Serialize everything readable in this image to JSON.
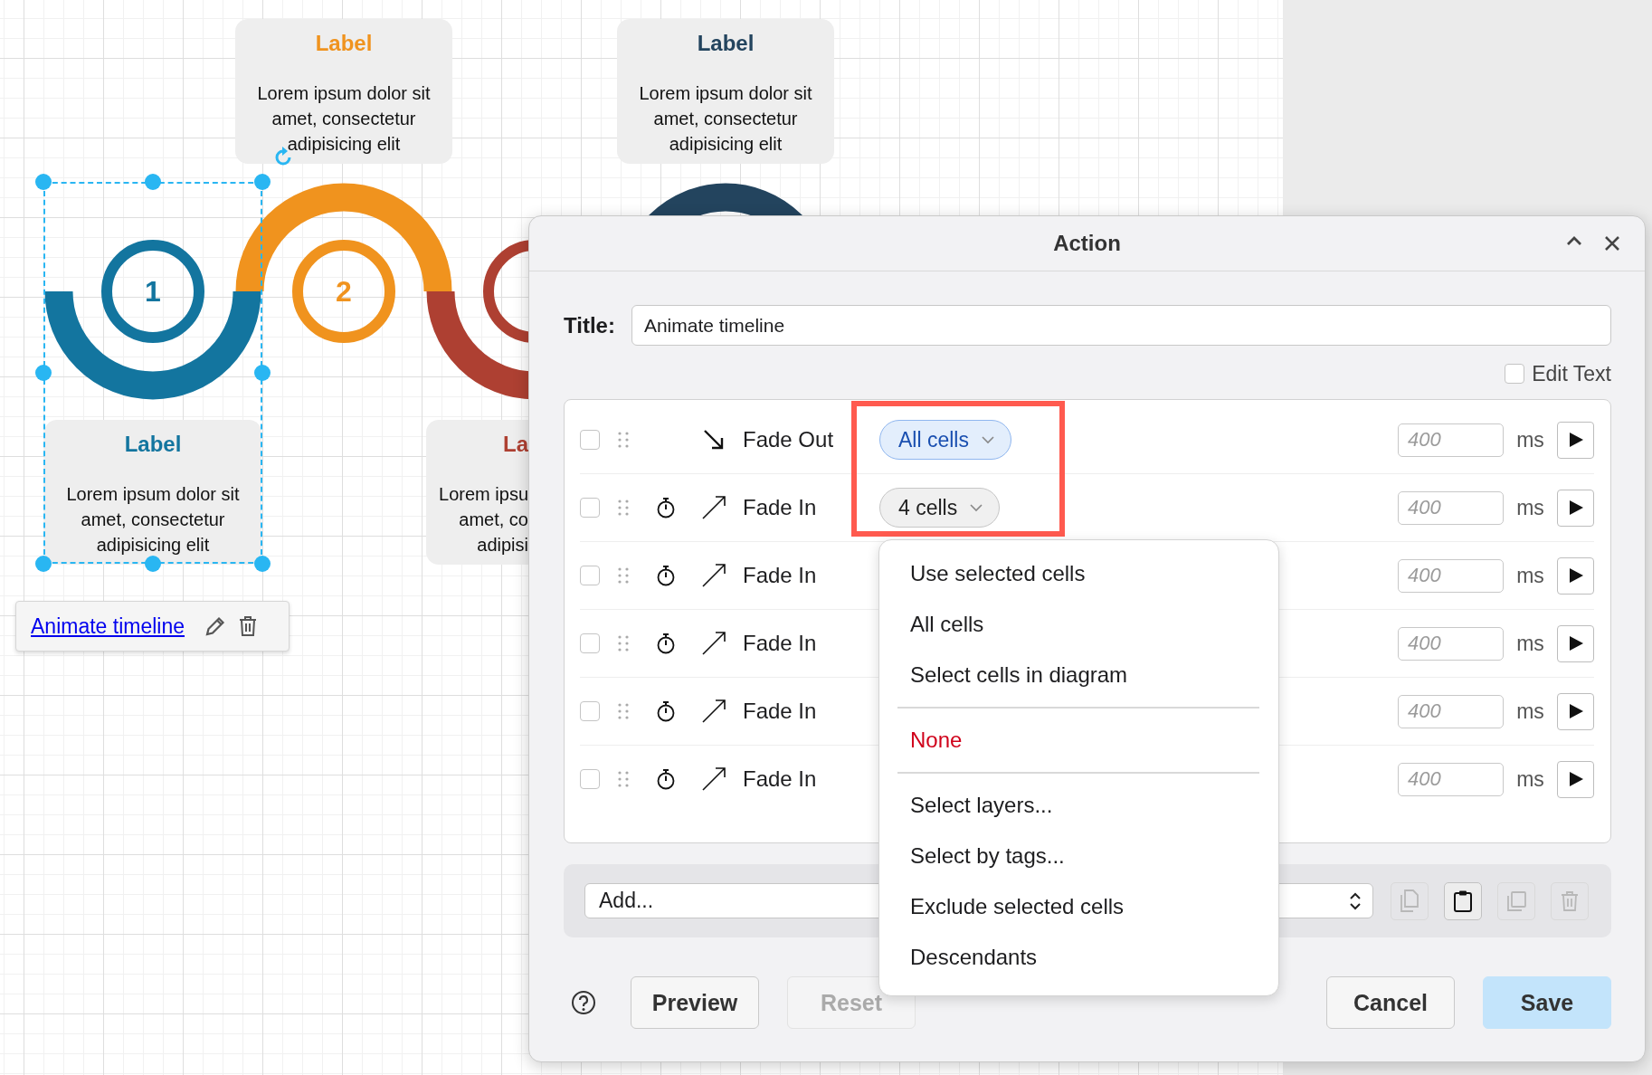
{
  "canvas": {
    "steps": [
      {
        "number": "1",
        "color": "#13759f",
        "selected": true,
        "label": {
          "title": "Label",
          "body": "Lorem ipsum dolor sit amet, consectetur adipisicing elit"
        }
      },
      {
        "number": "2",
        "color": "#f0931e",
        "selected": false,
        "label": {
          "title": "Label",
          "body": "Lorem ipsum dolor sit amet, consectetur adipisicing elit"
        }
      },
      {
        "color": "#ae4032",
        "selected": false,
        "label": {
          "title": "La",
          "lines": [
            "Lorem ipsu",
            "amet, co",
            "adipisi"
          ]
        }
      },
      {
        "color": "#23445e",
        "selected": false,
        "label": {
          "title": "Label",
          "body": "Lorem ipsum dolor sit amet, consectetur adipisicing elit"
        }
      }
    ],
    "link": {
      "text": "Animate timeline"
    }
  },
  "dialog": {
    "title": "Action",
    "title_label": "Title:",
    "title_value": "Animate timeline",
    "edit_text": {
      "label": "Edit Text",
      "checked": false
    },
    "highlight_targets": true,
    "rows": [
      {
        "checked": false,
        "delayed": false,
        "kind": "fade-out",
        "effect": "Fade Out",
        "target": {
          "label": "All cells",
          "selected": true
        },
        "duration_placeholder": "400",
        "unit": "ms"
      },
      {
        "checked": false,
        "delayed": true,
        "kind": "fade-in",
        "effect": "Fade In",
        "target": {
          "label": "4 cells",
          "selected": false
        },
        "duration_placeholder": "400",
        "unit": "ms"
      },
      {
        "checked": false,
        "delayed": true,
        "kind": "fade-in",
        "effect": "Fade In",
        "duration_placeholder": "400",
        "unit": "ms"
      },
      {
        "checked": false,
        "delayed": true,
        "kind": "fade-in",
        "effect": "Fade In",
        "duration_placeholder": "400",
        "unit": "ms"
      },
      {
        "checked": false,
        "delayed": true,
        "kind": "fade-in",
        "effect": "Fade In",
        "duration_placeholder": "400",
        "unit": "ms"
      },
      {
        "checked": false,
        "delayed": true,
        "kind": "fade-in",
        "effect": "Fade In",
        "duration_placeholder": "400",
        "unit": "ms"
      }
    ],
    "menu": [
      {
        "kind": "item",
        "label": "Use selected cells"
      },
      {
        "kind": "item",
        "label": "All cells"
      },
      {
        "kind": "item",
        "label": "Select cells in diagram"
      },
      {
        "kind": "divider"
      },
      {
        "kind": "danger",
        "label": "None"
      },
      {
        "kind": "divider"
      },
      {
        "kind": "item",
        "label": "Select layers..."
      },
      {
        "kind": "item",
        "label": "Select by tags..."
      },
      {
        "kind": "item",
        "label": "Exclude selected cells"
      },
      {
        "kind": "item",
        "label": "Descendants"
      }
    ],
    "add_select": {
      "value": "Add..."
    },
    "tools": [
      {
        "kind": "copy",
        "disabled": true
      },
      {
        "kind": "paste",
        "disabled": false
      },
      {
        "kind": "duplicate",
        "disabled": true
      },
      {
        "kind": "delete",
        "disabled": true
      }
    ],
    "buttons": [
      {
        "kind": "help"
      },
      {
        "kind": "secondary",
        "label": "Preview",
        "disabled": false
      },
      {
        "kind": "secondary",
        "label": "Reset",
        "disabled": true
      },
      {
        "kind": "spacer"
      },
      {
        "kind": "secondary",
        "label": "Cancel",
        "disabled": false
      },
      {
        "kind": "primary",
        "label": "Save",
        "disabled": false
      }
    ]
  }
}
